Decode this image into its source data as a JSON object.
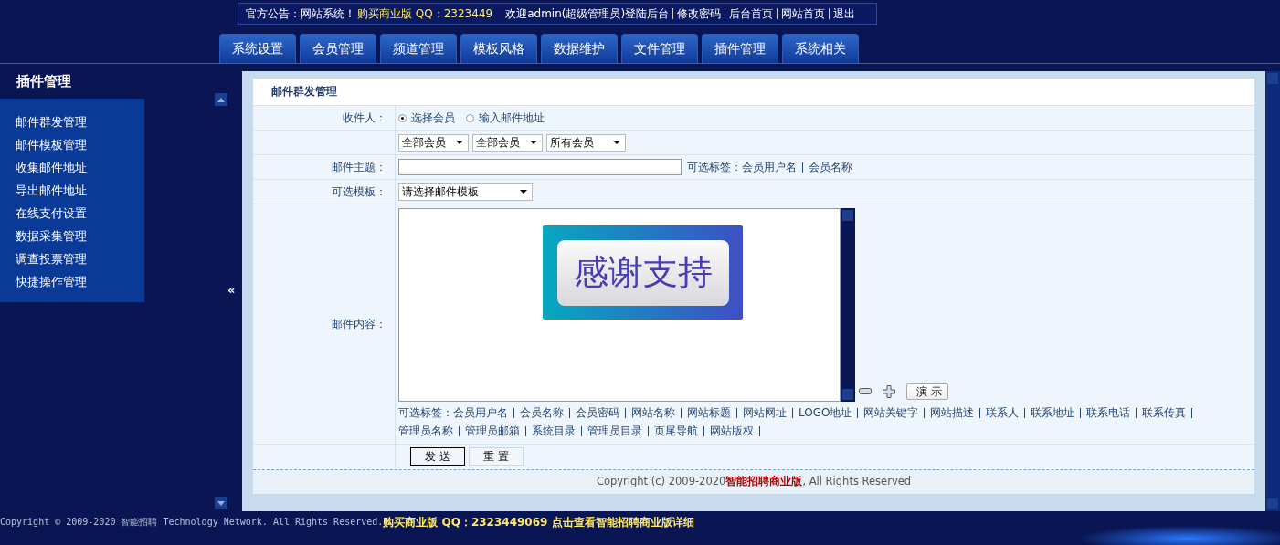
{
  "top_bar": {
    "notice_label": "官方公告：",
    "notice_text": "网站系统！",
    "notice_promo": "购买商业版 QQ：2323449",
    "welcome": "欢迎admin(超级管理员)登陆后台",
    "links": [
      "修改密码",
      "后台首页",
      "网站首页",
      "退出"
    ]
  },
  "tabs": [
    "系统设置",
    "会员管理",
    "频道管理",
    "模板风格",
    "数据维护",
    "文件管理",
    "插件管理",
    "系统相关"
  ],
  "sidebar": {
    "title": "插件管理",
    "items": [
      "邮件群发管理",
      "邮件模板管理",
      "收集邮件地址",
      "导出邮件地址",
      "在线支付设置",
      "数据采集管理",
      "调查投票管理",
      "快捷操作管理"
    ],
    "collapse_toggle": "«"
  },
  "panel": {
    "title": "邮件群发管理",
    "recipient": {
      "label": "收件人：",
      "options": [
        {
          "label": "选择会员",
          "selected": true
        },
        {
          "label": "输入邮件地址",
          "selected": false
        }
      ]
    },
    "filters": [
      "全部会员",
      "全部会员",
      "所有会员"
    ],
    "subject": {
      "label": "邮件主题：",
      "tags_label": "可选标签：",
      "tags": [
        "会员用户名",
        "会员名称"
      ]
    },
    "template": {
      "label": "可选模板：",
      "value": "请选择邮件模板"
    },
    "content": {
      "label": "邮件内容：",
      "banner_text": "感谢支持",
      "preview_button": "演 示",
      "tags_label": "可选标签：",
      "tags": [
        "会员用户名",
        "会员名称",
        "会员密码",
        "网站名称",
        "网站标题",
        "网站网址",
        "LOGO地址",
        "网站关键字",
        "网站描述",
        "联系人",
        "联系地址",
        "联系电话",
        "联系传真",
        "管理员名称",
        "管理员邮箱",
        "系统目录",
        "管理员目录",
        "页尾导航",
        "网站版权"
      ]
    },
    "buttons": [
      "发 送",
      "重 置"
    ],
    "copyright": "Copyright (c) 2009-2020**智能招聘商业版**, All Rights Reserved"
  },
  "footer": {
    "copyright": "Copyright © 2009-2020 智能招聘 Technology Network. All Rights Reserved.",
    "promo": "购买商业版 QQ：2323449069 点击查看智能招聘商业版详细"
  }
}
